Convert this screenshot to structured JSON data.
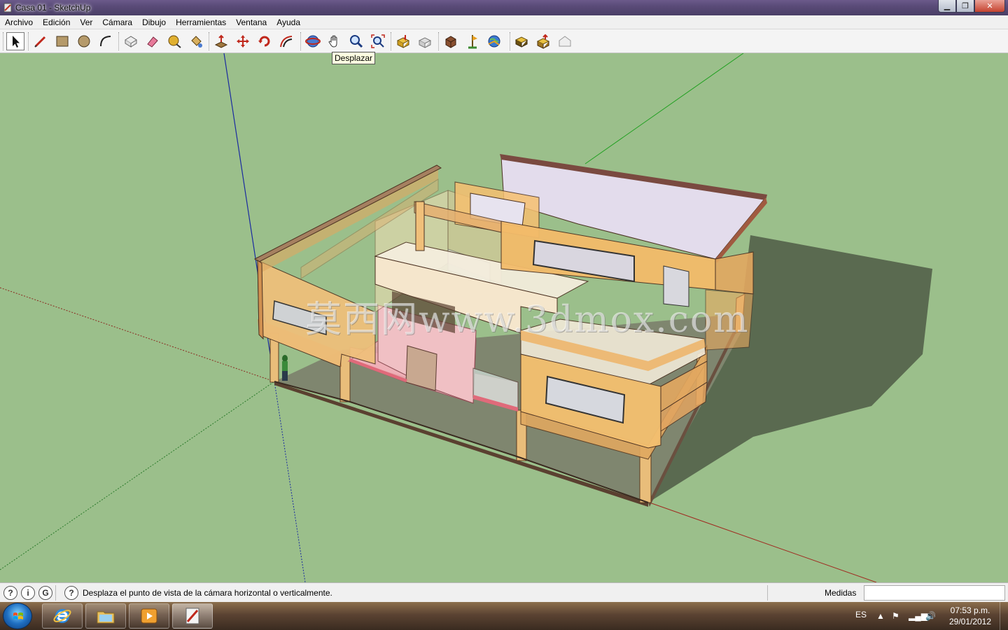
{
  "window": {
    "title": "Casa 01 - SketchUp",
    "app_icon": "sketchup-icon",
    "controls": {
      "minimize": "minimize-icon",
      "maximize": "maximize-icon",
      "close": "close-icon"
    }
  },
  "menu": {
    "items": [
      {
        "label": "Archivo"
      },
      {
        "label": "Edición"
      },
      {
        "label": "Ver"
      },
      {
        "label": "Cámara"
      },
      {
        "label": "Dibujo"
      },
      {
        "label": "Herramientas"
      },
      {
        "label": "Ventana"
      },
      {
        "label": "Ayuda"
      }
    ]
  },
  "toolbar": {
    "tools": [
      {
        "icon": "select-arrow-icon",
        "selected": true
      },
      {
        "icon": "pencil-line-icon"
      },
      {
        "icon": "rectangle-icon"
      },
      {
        "icon": "circle-icon"
      },
      {
        "icon": "arc-icon"
      },
      {
        "icon": "make-component-icon"
      },
      {
        "icon": "eraser-icon"
      },
      {
        "icon": "tape-measure-icon"
      },
      {
        "icon": "paint-bucket-icon"
      },
      {
        "icon": "push-pull-icon"
      },
      {
        "icon": "move-icon"
      },
      {
        "icon": "rotate-icon"
      },
      {
        "icon": "offset-icon"
      },
      {
        "icon": "orbit-icon"
      },
      {
        "icon": "pan-hand-icon"
      },
      {
        "icon": "zoom-icon"
      },
      {
        "icon": "zoom-extents-icon"
      },
      {
        "icon": "get-models-icon"
      },
      {
        "icon": "share-model-icon"
      },
      {
        "icon": "components-icon"
      },
      {
        "icon": "place-model-icon"
      },
      {
        "icon": "google-earth-icon"
      },
      {
        "icon": "preview-earth-icon"
      },
      {
        "icon": "toggle-terrain-icon"
      },
      {
        "icon": "photo-textures-icon"
      }
    ],
    "tooltip": "Desplazar"
  },
  "viewport": {
    "background": "#9bbf8b",
    "watermark": "莫西网www.3dmox.com"
  },
  "statusbar": {
    "icons": [
      "geo-location-icon",
      "credits-icon",
      "user-icon"
    ],
    "help_icon": "help-question-icon",
    "message": "Desplaza el punto de vista de la cámara horizontal o verticalmente.",
    "measure_label": "Medidas",
    "measure_value": ""
  },
  "taskbar": {
    "start_icon": "windows-start-icon",
    "apps": [
      {
        "icon": "internet-explorer-icon"
      },
      {
        "icon": "file-explorer-icon"
      },
      {
        "icon": "media-player-icon"
      },
      {
        "icon": "sketchup-taskbar-icon",
        "active": true
      }
    ],
    "language": "ES",
    "tray_icons": [
      "show-hidden-icons-icon",
      "action-center-flag-icon",
      "network-signal-icon",
      "volume-icon"
    ],
    "time": "07:53 p.m.",
    "date": "29/01/2012"
  }
}
